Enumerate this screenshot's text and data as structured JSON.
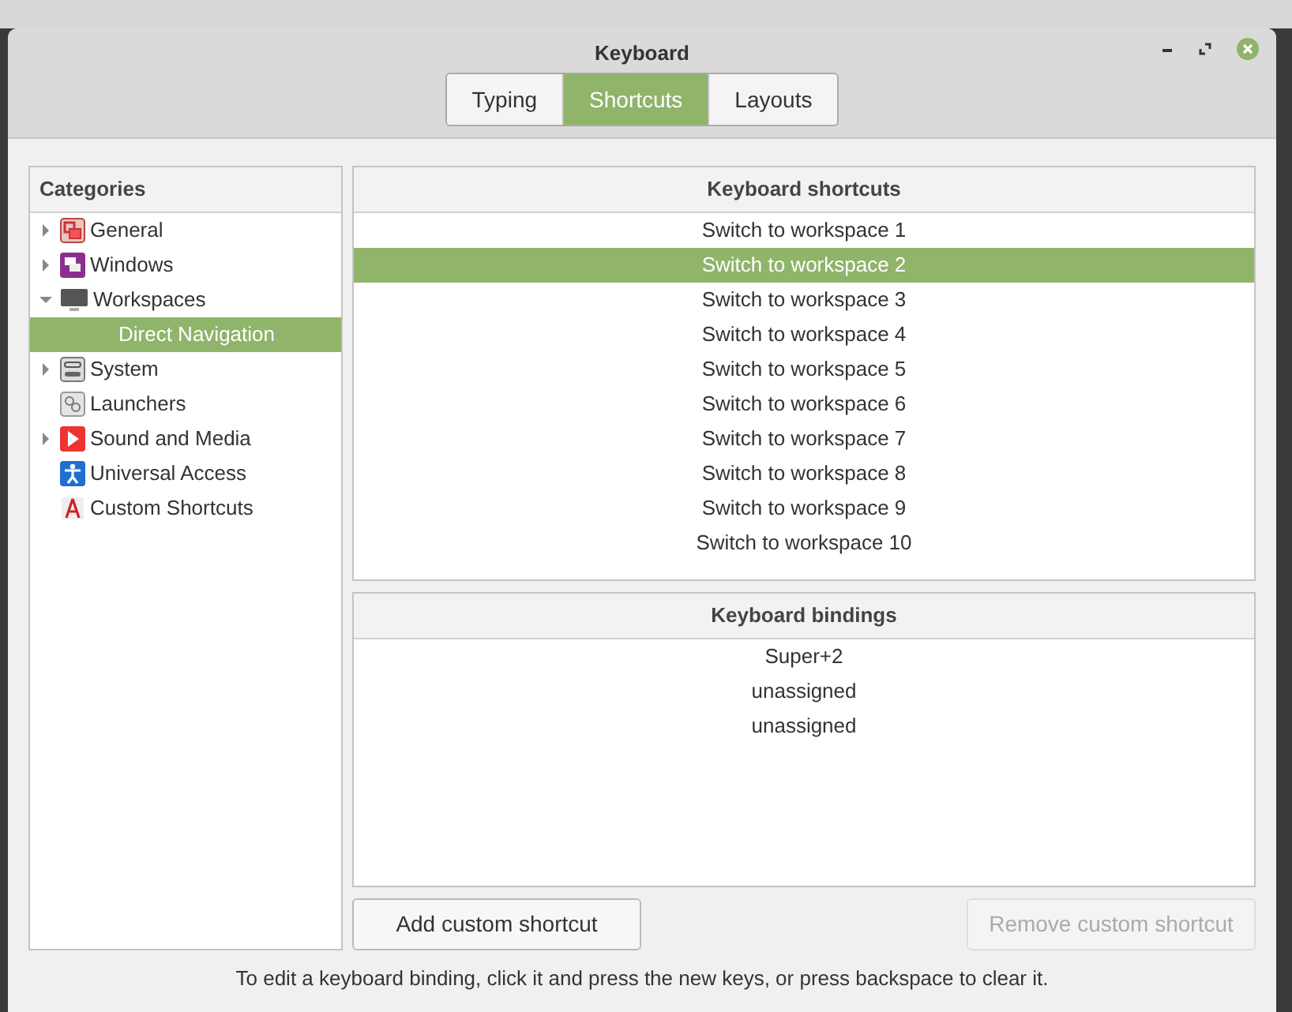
{
  "window": {
    "title": "Keyboard"
  },
  "tabs": [
    {
      "label": "Typing",
      "selected": false
    },
    {
      "label": "Shortcuts",
      "selected": true
    },
    {
      "label": "Layouts",
      "selected": false
    }
  ],
  "categories": {
    "header": "Categories",
    "items": [
      {
        "label": "General",
        "expanded": false,
        "has_children": true,
        "selected": false
      },
      {
        "label": "Windows",
        "expanded": false,
        "has_children": true,
        "selected": false
      },
      {
        "label": "Workspaces",
        "expanded": true,
        "has_children": true,
        "selected": false,
        "children": [
          {
            "label": "Direct Navigation",
            "selected": true
          }
        ]
      },
      {
        "label": "System",
        "expanded": false,
        "has_children": true,
        "selected": false
      },
      {
        "label": "Launchers",
        "has_children": false,
        "selected": false
      },
      {
        "label": "Sound and Media",
        "expanded": false,
        "has_children": true,
        "selected": false
      },
      {
        "label": "Universal Access",
        "has_children": false,
        "selected": false
      },
      {
        "label": "Custom Shortcuts",
        "has_children": false,
        "selected": false
      }
    ]
  },
  "shortcuts": {
    "header": "Keyboard shortcuts",
    "rows": [
      {
        "label": "Switch to workspace 1",
        "selected": false
      },
      {
        "label": "Switch to workspace 2",
        "selected": true
      },
      {
        "label": "Switch to workspace 3",
        "selected": false
      },
      {
        "label": "Switch to workspace 4",
        "selected": false
      },
      {
        "label": "Switch to workspace 5",
        "selected": false
      },
      {
        "label": "Switch to workspace 6",
        "selected": false
      },
      {
        "label": "Switch to workspace 7",
        "selected": false
      },
      {
        "label": "Switch to workspace 8",
        "selected": false
      },
      {
        "label": "Switch to workspace 9",
        "selected": false
      },
      {
        "label": "Switch to workspace 10",
        "selected": false
      }
    ]
  },
  "bindings": {
    "header": "Keyboard bindings",
    "rows": [
      "Super+2",
      "unassigned",
      "unassigned"
    ]
  },
  "buttons": [
    {
      "label": "Add custom shortcut",
      "disabled": false
    },
    {
      "label": "Remove custom shortcut",
      "disabled": true
    }
  ],
  "hint": "To edit a keyboard binding, click it and press the new keys, or press backspace to clear it."
}
